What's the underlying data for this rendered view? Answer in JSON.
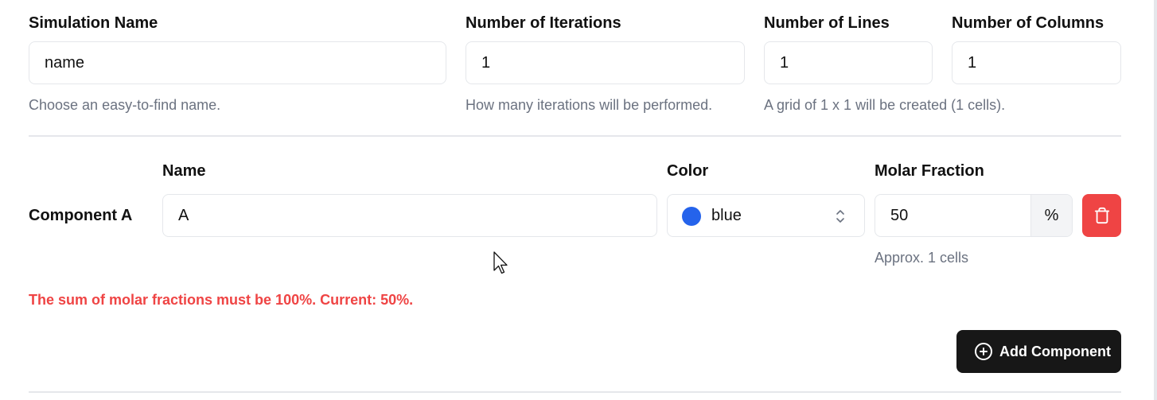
{
  "simulation": {
    "name_label": "Simulation Name",
    "name_value": "name",
    "name_help": "Choose an easy-to-find name.",
    "iterations_label": "Number of Iterations",
    "iterations_value": "1",
    "iterations_help": "How many iterations will be performed.",
    "lines_label": "Number of Lines",
    "lines_value": "1",
    "columns_label": "Number of Columns",
    "columns_value": "1",
    "grid_help": "A grid of 1 x 1 will be created (1 cells)."
  },
  "components_header": {
    "name": "Name",
    "color": "Color",
    "molar_fraction": "Molar Fraction"
  },
  "components": [
    {
      "label": "Component A",
      "name_value": "A",
      "color_value": "blue",
      "color_hex": "#2563eb",
      "molar_value": "50",
      "molar_unit": "%",
      "cells_help": "Approx. 1 cells"
    }
  ],
  "error_message": "The sum of molar fractions must be 100%. Current: 50%.",
  "add_component_label": "Add Component",
  "colors": {
    "danger": "#ef4444",
    "primary_button": "#171717",
    "muted_text": "#6b7280",
    "border": "#e5e7eb"
  },
  "icons": {
    "delete": "trash-icon",
    "add": "plus-circle-icon",
    "select": "chevrons-up-down-icon",
    "cursor": "mouse-pointer-icon"
  }
}
